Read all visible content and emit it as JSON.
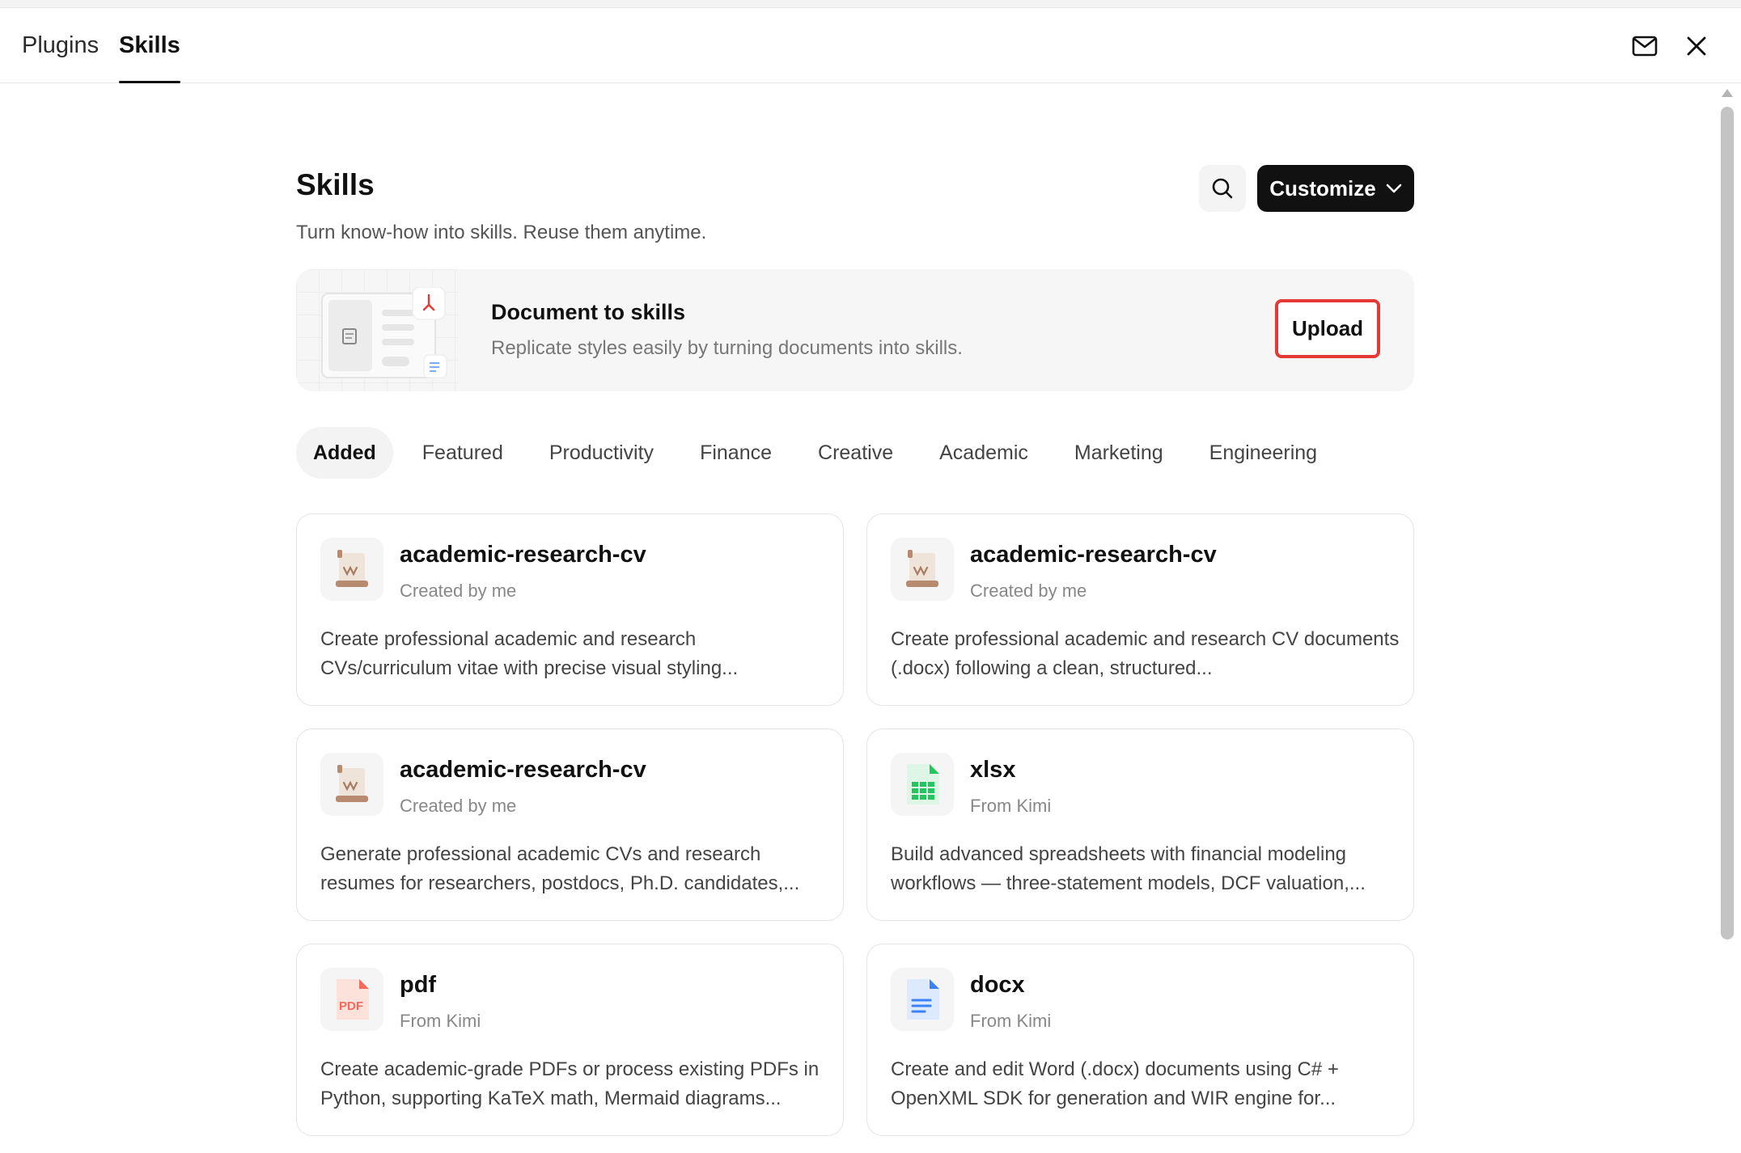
{
  "header": {
    "tabs": [
      {
        "label": "Plugins",
        "active": false
      },
      {
        "label": "Skills",
        "active": true
      }
    ],
    "icons": [
      "mail-icon",
      "close-icon"
    ]
  },
  "page": {
    "title": "Skills",
    "subtitle": "Turn know-how into skills. Reuse them anytime.",
    "customize_label": "Customize"
  },
  "banner": {
    "title": "Document to skills",
    "subtitle": "Replicate styles easily by turning documents into skills.",
    "upload_label": "Upload"
  },
  "filters": [
    {
      "label": "Added",
      "active": true
    },
    {
      "label": "Featured",
      "active": false
    },
    {
      "label": "Productivity",
      "active": false
    },
    {
      "label": "Finance",
      "active": false
    },
    {
      "label": "Creative",
      "active": false
    },
    {
      "label": "Academic",
      "active": false
    },
    {
      "label": "Marketing",
      "active": false
    },
    {
      "label": "Engineering",
      "active": false
    }
  ],
  "cards": [
    {
      "title": "academic-research-cv",
      "meta": "Created by me",
      "desc": "Create professional academic and research CVs/curriculum vitae with precise visual styling...",
      "icon": "scroll-icon"
    },
    {
      "title": "academic-research-cv",
      "meta": "Created by me",
      "desc": "Create professional academic and research CV documents (.docx) following a clean, structured...",
      "icon": "scroll-icon"
    },
    {
      "title": "academic-research-cv",
      "meta": "Created by me",
      "desc": "Generate professional academic CVs and research resumes for researchers, postdocs, Ph.D. candidates,...",
      "icon": "scroll-icon"
    },
    {
      "title": "xlsx",
      "meta": "From Kimi",
      "desc": "Build advanced spreadsheets with financial modeling workflows — three-statement models, DCF valuation,...",
      "icon": "spreadsheet-icon"
    },
    {
      "title": "pdf",
      "meta": "From Kimi",
      "desc": "Create academic-grade PDFs or process existing PDFs in Python, supporting KaTeX math, Mermaid diagrams...",
      "icon": "pdf-file-icon",
      "icon_text": "PDF"
    },
    {
      "title": "docx",
      "meta": "From Kimi",
      "desc": "Create and edit Word (.docx) documents using C# + OpenXML SDK for generation and WIR engine for...",
      "icon": "word-document-icon"
    }
  ],
  "colors": {
    "accent_dark": "#111111",
    "upload_outline": "#e53935",
    "xlsx_green": "#22c55e",
    "pdf_red": "#f26b5b",
    "docx_blue": "#3b82f6"
  }
}
